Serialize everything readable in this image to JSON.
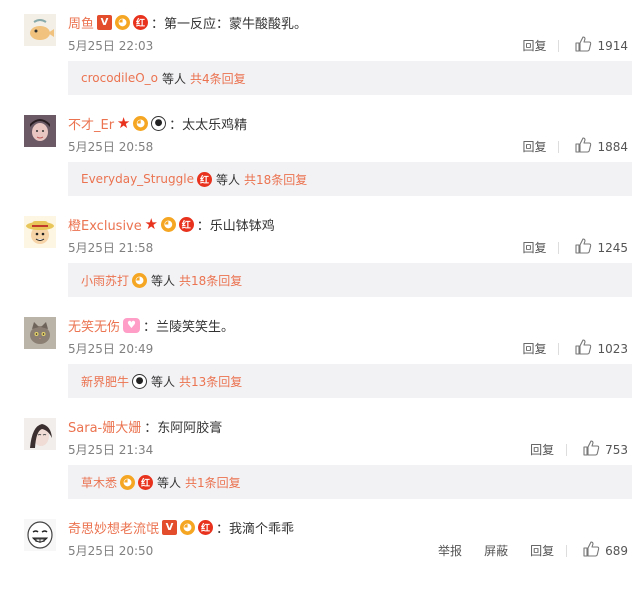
{
  "comments": [
    {
      "username": "周鱼",
      "badges": [
        "v-badge",
        "face-badge",
        "hong-badge"
      ],
      "text": "第一反应：蒙牛酸酸乳。",
      "time": "5月25日 22:03",
      "reply_label": "回复",
      "likes": "1914",
      "reply_preview": {
        "name": "crocodileO_o",
        "badges": [],
        "suffix": "等人",
        "total": "共4条回复"
      }
    },
    {
      "username": "不才_Er",
      "badges": [
        "star-badge",
        "face-badge",
        "panda-badge"
      ],
      "text": "太太乐鸡精",
      "time": "5月25日 20:58",
      "reply_label": "回复",
      "likes": "1884",
      "reply_preview": {
        "name": "Everyday_Struggle",
        "badges": [
          "hong-badge"
        ],
        "suffix": "等人",
        "total": "共18条回复"
      }
    },
    {
      "username": "橙Exclusive",
      "badges": [
        "star-badge",
        "face-badge",
        "hong-badge"
      ],
      "text": "乐山钵钵鸡",
      "time": "5月25日 21:58",
      "reply_label": "回复",
      "likes": "1245",
      "reply_preview": {
        "name": "小雨苏打",
        "badges": [
          "face-badge"
        ],
        "suffix": "等人",
        "total": "共18条回复"
      }
    },
    {
      "username": "无笑无伤",
      "badges": [
        "heart-badge"
      ],
      "text": "兰陵笑笑生。",
      "time": "5月25日 20:49",
      "reply_label": "回复",
      "likes": "1023",
      "reply_preview": {
        "name": "新界肥牛",
        "badges": [
          "panda-badge"
        ],
        "suffix": "等人",
        "total": "共13条回复"
      }
    },
    {
      "username": "Sara-姗大姗",
      "badges": [],
      "text": "东阿阿胶膏",
      "time": "5月25日 21:34",
      "reply_label": "回复",
      "likes": "753",
      "reply_preview": {
        "name": "草木悉",
        "badges": [
          "face-badge",
          "hong-badge"
        ],
        "suffix": "等人",
        "total": "共1条回复"
      }
    },
    {
      "username": "奇思妙想老流氓",
      "badges": [
        "v-badge",
        "face-badge",
        "hong-badge"
      ],
      "text": "我滴个乖乖",
      "time": "5月25日 20:50",
      "report_label": "举报",
      "block_label": "屏蔽",
      "reply_label": "回复",
      "likes": "689"
    }
  ],
  "badge_glyphs": {
    "v-badge": "V",
    "star-badge": "★",
    "face-badge": "◕",
    "hong-badge": "红",
    "panda-badge": "●",
    "heart-badge": "♥"
  },
  "colors": {
    "username": "#eb7350",
    "reply_bg": "#f2f2f5",
    "meta": "#808080"
  }
}
